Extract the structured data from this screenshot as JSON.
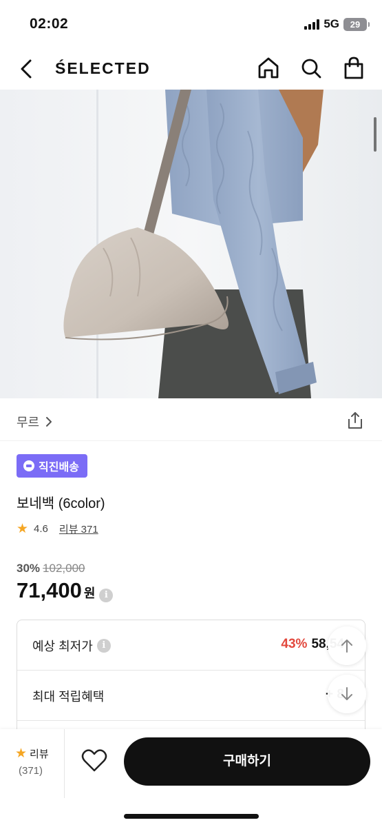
{
  "status_bar": {
    "time": "02:02",
    "network": "5G",
    "battery": "29"
  },
  "header": {
    "brand": "ŚELECTED",
    "icons": [
      "back-arrow-icon",
      "home-icon",
      "search-icon",
      "shopping-bag-icon"
    ]
  },
  "product": {
    "brand_link": "무르",
    "shipping_badge": "직진배송",
    "name": "보네백 (6color)",
    "rating": "4.6",
    "review_link": "리뷰 371",
    "discount_rate": "30%",
    "original_price": "102,000",
    "final_price": "71,400",
    "currency": "원"
  },
  "benefits": [
    {
      "label": "예상 최저가",
      "percent": "43%",
      "value": "58,54"
    },
    {
      "label": "최대 적립혜택",
      "percent": "",
      "value": "+ 8"
    }
  ],
  "bottom_bar": {
    "review_label": "리뷰",
    "review_count": "(371)",
    "buy_label": "구매하기"
  },
  "colors": {
    "badge": "#7b6cf6",
    "discount_red": "#e2483d",
    "star": "#f5a623",
    "buy_button": "#111111"
  }
}
